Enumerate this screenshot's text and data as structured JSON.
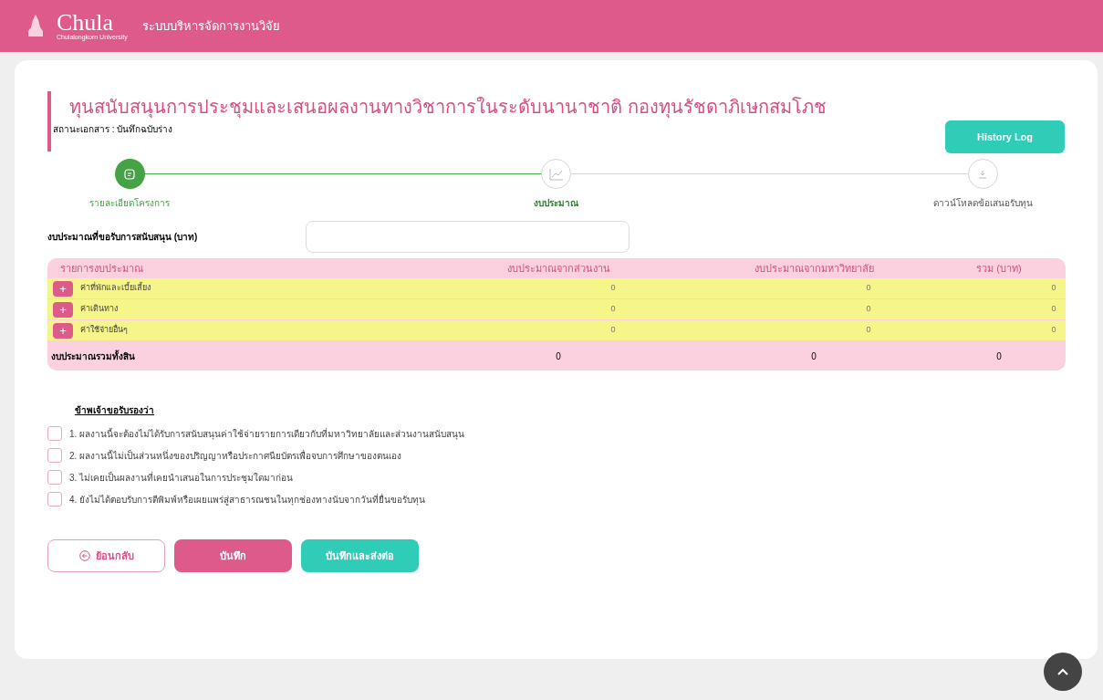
{
  "header": {
    "logo_text": "Chula",
    "logo_subtitle": "Chulalongkorn University",
    "system_name": "ระบบบริหารจัดการงานวิจัย"
  },
  "page": {
    "title": "ทุนสนับสนุนการประชุมและเสนอผลงานทางวิชาการในระดับนานาชาติ กองทุนรัชดาภิเษกสมโภช",
    "status": "สถานะเอกสาร : บันทึกฉบับร่าง",
    "history_button": "History Log"
  },
  "steps": [
    {
      "label": "รายละเอียดโครงการ",
      "completed": true,
      "selected": false,
      "kind": "document"
    },
    {
      "label": "งบประมาณ",
      "completed": false,
      "selected": true,
      "kind": "chart"
    },
    {
      "label": "ดาวน์โหลดข้อเสนอรับทุน",
      "completed": false,
      "selected": false,
      "kind": "download"
    }
  ],
  "budget_request": {
    "label": "งบประมาณที่ขอรับการสนับสนุน (บาท)"
  },
  "table": {
    "columns": [
      "รายการงบประมาณ",
      "งบประมาณจากส่วนงาน",
      "งบประมาณจากมหาวิทยาลัย",
      "รวม (บาท)"
    ],
    "rows": [
      {
        "add_icon": "+",
        "cells": [
          "ค่าที่พักและเบี้ยเลี้ยง",
          "0",
          "0",
          "0"
        ]
      },
      {
        "add_icon": "+",
        "cells": [
          "ค่าเดินทาง",
          "0",
          "0",
          "0"
        ]
      },
      {
        "add_icon": "+",
        "cells": [
          "ค่าใช้จ่ายอื่นๆ",
          "0",
          "0",
          "0"
        ]
      }
    ],
    "total": [
      "งบประมาณรวมทั้งสิน",
      "0",
      "0",
      "0"
    ]
  },
  "certification": {
    "heading": "ข้าพเจ้าขอรับรองว่า",
    "items": [
      {
        "label": "1. ผลงานนี้จะต้องไม่ได้รับการสนับสนุนค่าใช้จ่ายรายการเดียวกับที่มหาวิทยาลัยและส่วนงานสนับสนุน",
        "checked": false
      },
      {
        "label": "2. ผลงานนี้ไม่เป็นส่วนหนึ่งของปริญญาหรือประกาศนียบัตรเพื่อจบการศึกษาของตนเอง",
        "checked": false
      },
      {
        "label": "3. ไม่เคยเป็นผลงานที่เคยนำเสนอในการประชุมใดมาก่อน",
        "checked": false
      },
      {
        "label": "4. ยังไม่ได้ตอบรับการตีพิมพ์หรือเผยแพร่สู่สาธารณชนในทุกช่องทางนับจากวันที่ยื่นขอรับทุน",
        "checked": false
      }
    ]
  },
  "buttons": [
    {
      "label": "ย้อนกลับ",
      "kind": "back"
    },
    {
      "label": "บันทึก",
      "kind": "save"
    },
    {
      "label": "บันทึกและส่งต่อ",
      "kind": "submit"
    }
  ]
}
